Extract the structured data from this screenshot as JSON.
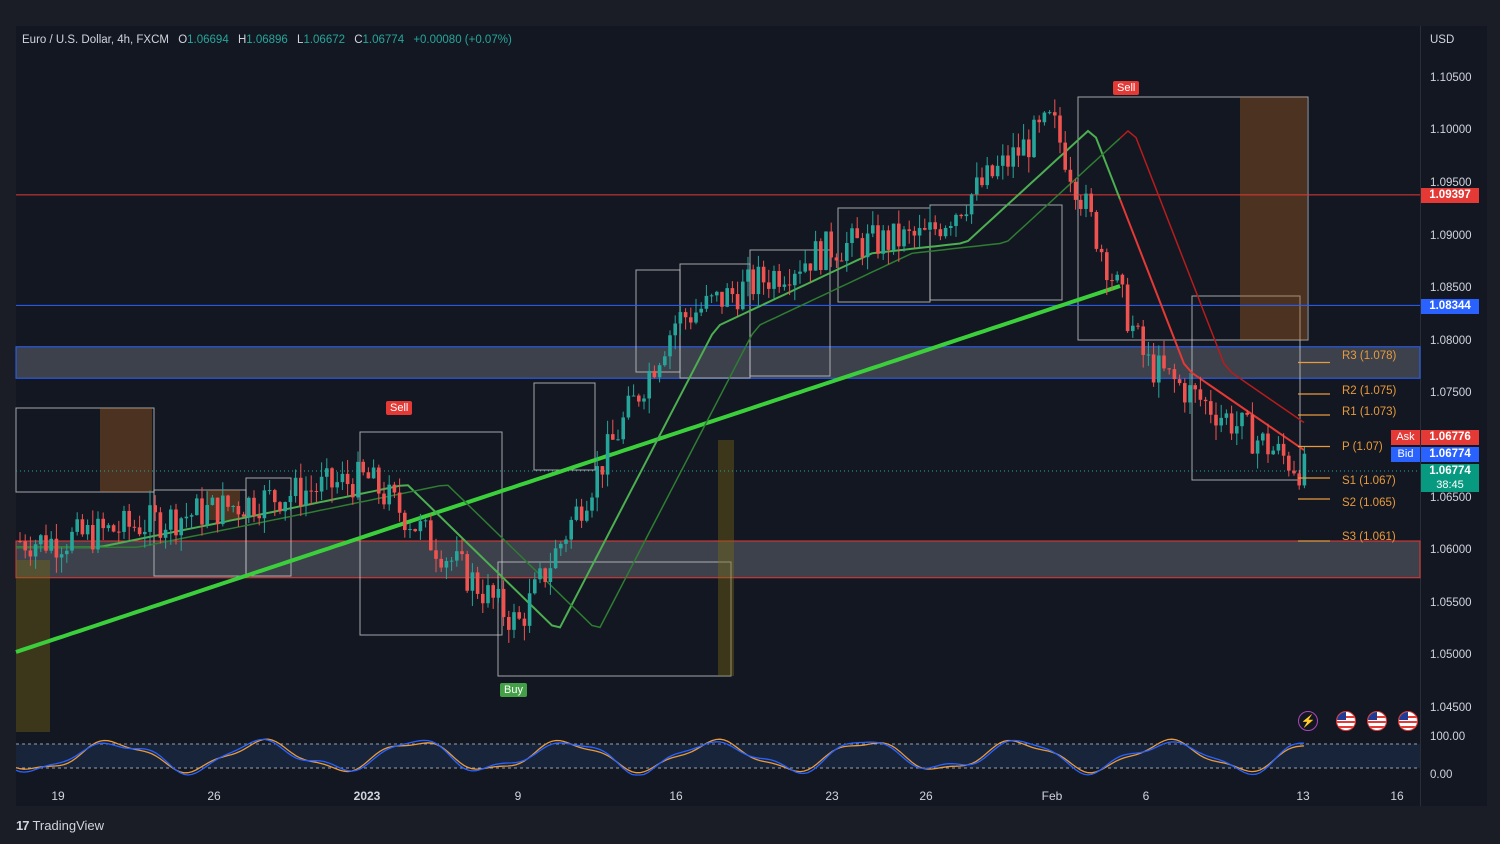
{
  "header": {
    "symbol": "Euro / U.S. Dollar, 4h, FXCM",
    "open_key": "O",
    "open_value": "1.06694",
    "high_key": "H",
    "high_value": "1.06896",
    "low_key": "L",
    "low_value": "1.06672",
    "close_key": "C",
    "close_value": "1.06774",
    "change": "+0.00080 (+0.07%)"
  },
  "axis": {
    "currency": "USD",
    "price_ticks": [
      "1.10500",
      "1.10000",
      "1.09500",
      "1.09000",
      "1.08500",
      "1.08000",
      "1.07500",
      "1.07000",
      "1.06500",
      "1.06000",
      "1.05500",
      "1.05000",
      "1.04500"
    ],
    "time_ticks": [
      "19",
      "26",
      "2023",
      "9",
      "16",
      "23",
      "26",
      "Feb",
      "6",
      "13",
      "16"
    ],
    "oscillator_ticks": [
      "100.00",
      "0.00"
    ]
  },
  "price_tags": {
    "red_line": "1.09397",
    "blue_line": "1.08344",
    "ask_label": "Ask",
    "ask_value": "1.06776",
    "bid_label": "Bid",
    "bid_value": "1.06774",
    "last_value": "1.06774",
    "countdown": "38:45"
  },
  "pivots": {
    "r3": "R3 (1.078)",
    "r2": "R2 (1.075)",
    "r1": "R1 (1.073)",
    "p": "P (1.07)",
    "s1": "S1 (1.067)",
    "s2": "S2 (1.065)",
    "s3": "S3 (1.061)"
  },
  "signals": {
    "sell_1": "Sell",
    "sell_2": "Sell",
    "buy_1": "Buy"
  },
  "branding": {
    "logo_mark": "17",
    "logo_text": "TradingView"
  },
  "icons": {
    "events": "lightning-icon",
    "flags": [
      "us-flag-icon",
      "us-flag-icon",
      "us-flag-icon"
    ]
  },
  "colors": {
    "background": "#131722",
    "bull": "#26a69a",
    "bear": "#ef5350",
    "resistance_line": "#e53935",
    "support_line": "#2962ff",
    "pivot": "#e89a3c",
    "ema_green": "#4caf50",
    "ema_red": "#e53935"
  },
  "chart_data": {
    "type": "line",
    "instrument": "Euro / U.S. Dollar",
    "timeframe": "4h",
    "x": [
      "19",
      "26",
      "2023",
      "9",
      "16",
      "23",
      "26",
      "Feb",
      "6",
      "13"
    ],
    "series": [
      {
        "values": [
          1.061,
          1.064,
          1.067,
          1.053,
          1.082,
          1.089,
          1.09,
          1.101,
          1.078,
          1.0677
        ]
      }
    ],
    "horizontal_lines": [
      1.09397,
      1.08344
    ],
    "zones": [
      [
        1.0765,
        1.0795
      ],
      [
        1.0575,
        1.061
      ]
    ],
    "pivots": {
      "R3": 1.078,
      "R2": 1.075,
      "R1": 1.073,
      "P": 1.07,
      "S1": 1.067,
      "S2": 1.065,
      "S3": 1.061
    },
    "ylim": [
      1.043,
      1.107
    ],
    "grid": false
  }
}
